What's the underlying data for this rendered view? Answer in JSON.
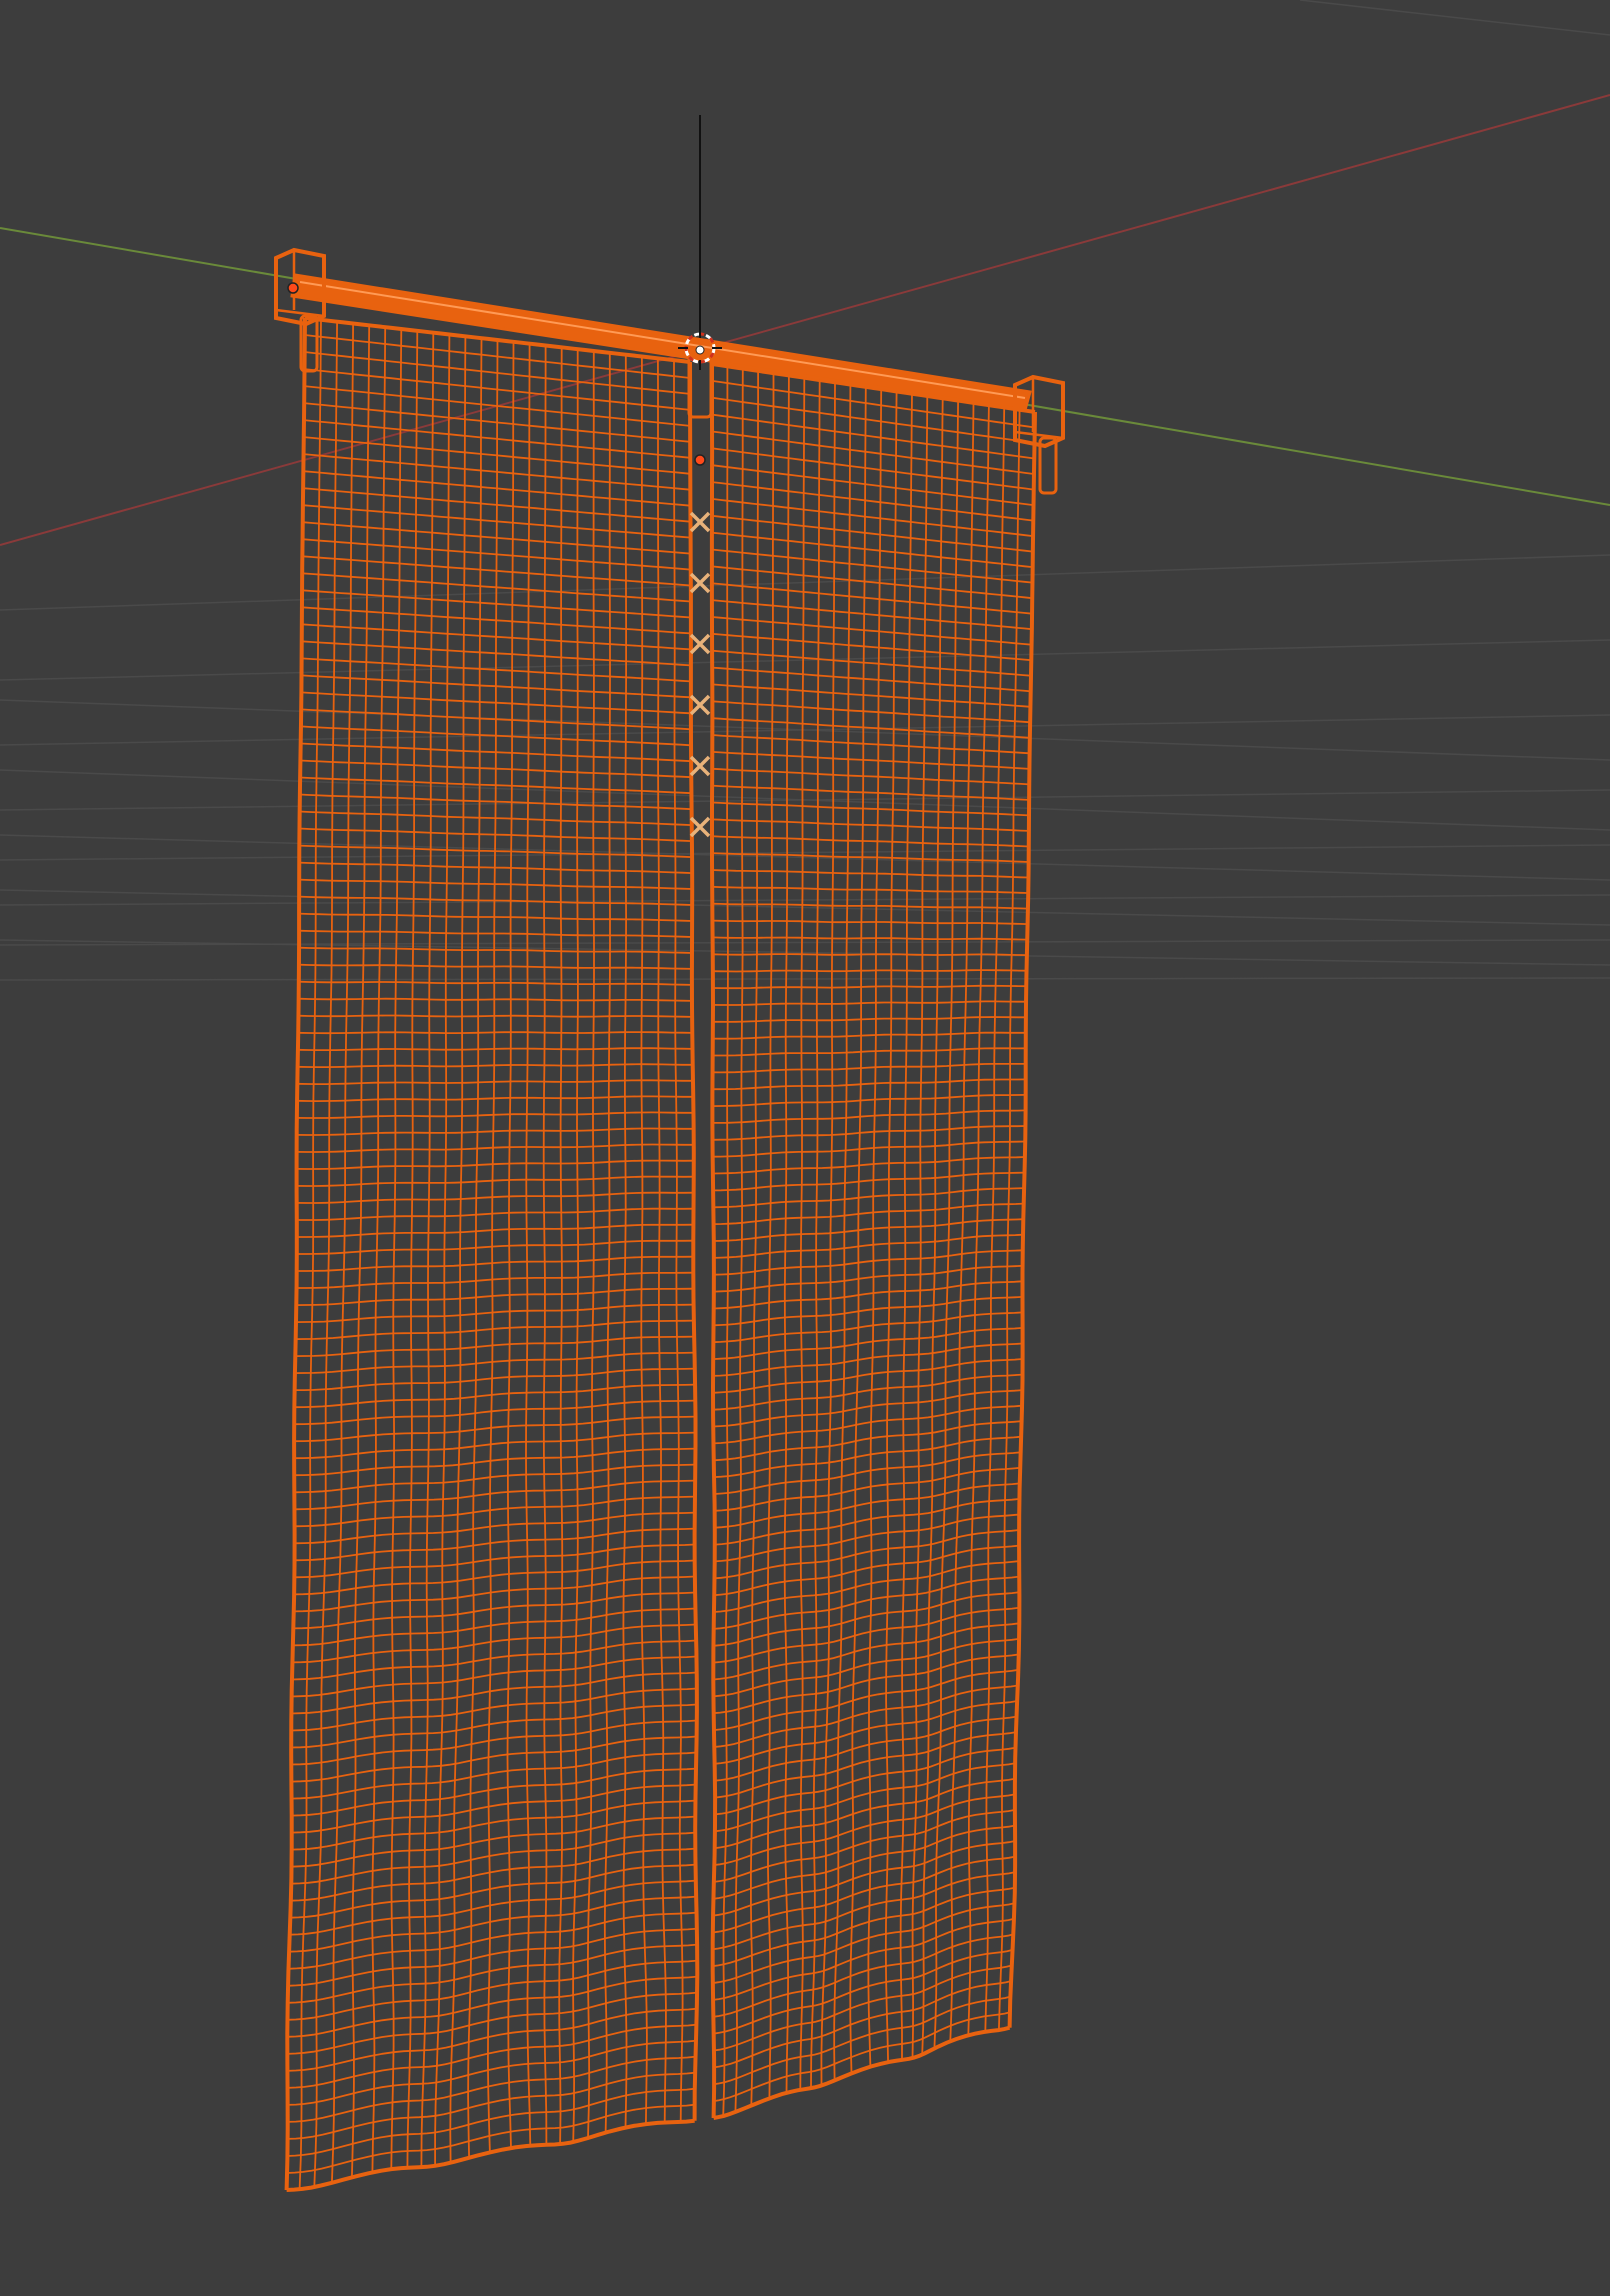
{
  "viewport": {
    "mode": "wireframe",
    "colors": {
      "background": "#3d3d3d",
      "grid": "#4a4a4a",
      "axis_x": "#8a3a3a",
      "axis_y": "#6a8a3a",
      "axis_z": "#111111",
      "selection": "#e8620f",
      "origin": "#ffffff"
    }
  },
  "objects": [
    {
      "name": "curtain-rod",
      "kind": "cylinder",
      "selected": true
    },
    {
      "name": "curtain-bracket-left",
      "kind": "bracket",
      "selected": true
    },
    {
      "name": "curtain-bracket-right",
      "kind": "bracket",
      "selected": true
    },
    {
      "name": "curtain-bracket-center",
      "kind": "bracket",
      "selected": true
    },
    {
      "name": "curtain-panel-left",
      "kind": "cloth",
      "selected": true
    },
    {
      "name": "curtain-panel-right",
      "kind": "cloth",
      "selected": true
    }
  ],
  "cursor": {
    "name": "3d-cursor"
  },
  "markers": {
    "count": 6,
    "icon": "x-marker"
  }
}
